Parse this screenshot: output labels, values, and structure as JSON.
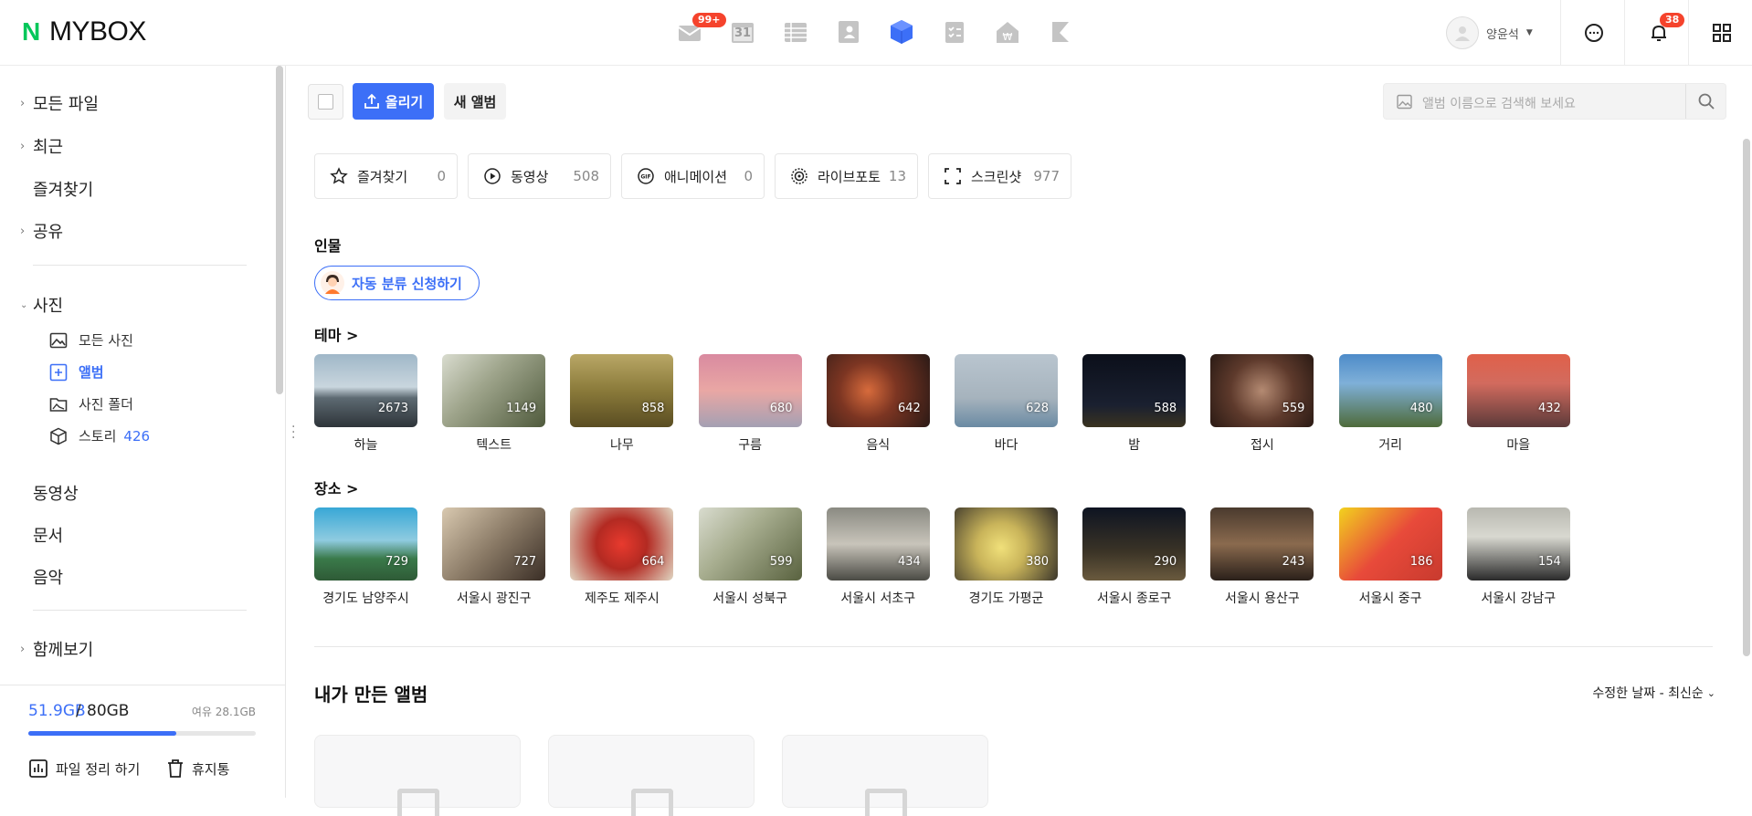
{
  "header": {
    "logo_mark": "N",
    "logo_text": "MYBOX",
    "mail_badge": "99+",
    "calendar_label": "31",
    "user_name": "양윤석",
    "notif_badge": "38"
  },
  "sidebar": {
    "all_files": "모든 파일",
    "recent": "최근",
    "favorites": "즐겨찾기",
    "shared": "공유",
    "photos": "사진",
    "all_photos": "모든 사진",
    "album": "앨범",
    "photo_folder": "사진 폴더",
    "story": "스토리",
    "story_count": "426",
    "videos": "동영상",
    "documents": "문서",
    "music": "음악",
    "together": "함께보기"
  },
  "storage": {
    "used": "51.9GB",
    "sep": "/",
    "total": "80GB",
    "free": "여유 28.1GB",
    "used_fraction": 0.649,
    "cleanup": "파일 정리 하기",
    "trash": "휴지통"
  },
  "toolbar": {
    "upload": "올리기",
    "new_album": "새 앨범",
    "search_placeholder": "앨범 이름으로 검색해 보세요"
  },
  "filters": [
    {
      "label": "즐겨찾기",
      "count": "0",
      "icon": "star-icon"
    },
    {
      "label": "동영상",
      "count": "508",
      "icon": "play-icon"
    },
    {
      "label": "애니메이션",
      "count": "0",
      "icon": "gif-icon"
    },
    {
      "label": "라이브포토",
      "count": "13",
      "icon": "live-photo-icon"
    },
    {
      "label": "스크린샷",
      "count": "977",
      "icon": "screenshot-icon"
    }
  ],
  "people": {
    "title": "인물",
    "auto_button": "자동 분류 신청하기"
  },
  "theme": {
    "title": "테마 >",
    "items": [
      {
        "name": "하늘",
        "count": "2673"
      },
      {
        "name": "텍스트",
        "count": "1149"
      },
      {
        "name": "나무",
        "count": "858"
      },
      {
        "name": "구름",
        "count": "680"
      },
      {
        "name": "음식",
        "count": "642"
      },
      {
        "name": "바다",
        "count": "628"
      },
      {
        "name": "밤",
        "count": "588"
      },
      {
        "name": "접시",
        "count": "559"
      },
      {
        "name": "거리",
        "count": "480"
      },
      {
        "name": "마을",
        "count": "432"
      }
    ]
  },
  "place": {
    "title": "장소 >",
    "items": [
      {
        "name": "경기도 남양주시",
        "count": "729"
      },
      {
        "name": "서울시 광진구",
        "count": "727"
      },
      {
        "name": "제주도 제주시",
        "count": "664"
      },
      {
        "name": "서울시 성북구",
        "count": "599"
      },
      {
        "name": "서울시 서초구",
        "count": "434"
      },
      {
        "name": "경기도 가평군",
        "count": "380"
      },
      {
        "name": "서울시 종로구",
        "count": "290"
      },
      {
        "name": "서울시 용산구",
        "count": "243"
      },
      {
        "name": "서울시 중구",
        "count": "186"
      },
      {
        "name": "서울시 강남구",
        "count": "154"
      }
    ]
  },
  "my_albums": {
    "title": "내가 만든 앨범",
    "sort": "수정한 날짜 - 최신순"
  }
}
